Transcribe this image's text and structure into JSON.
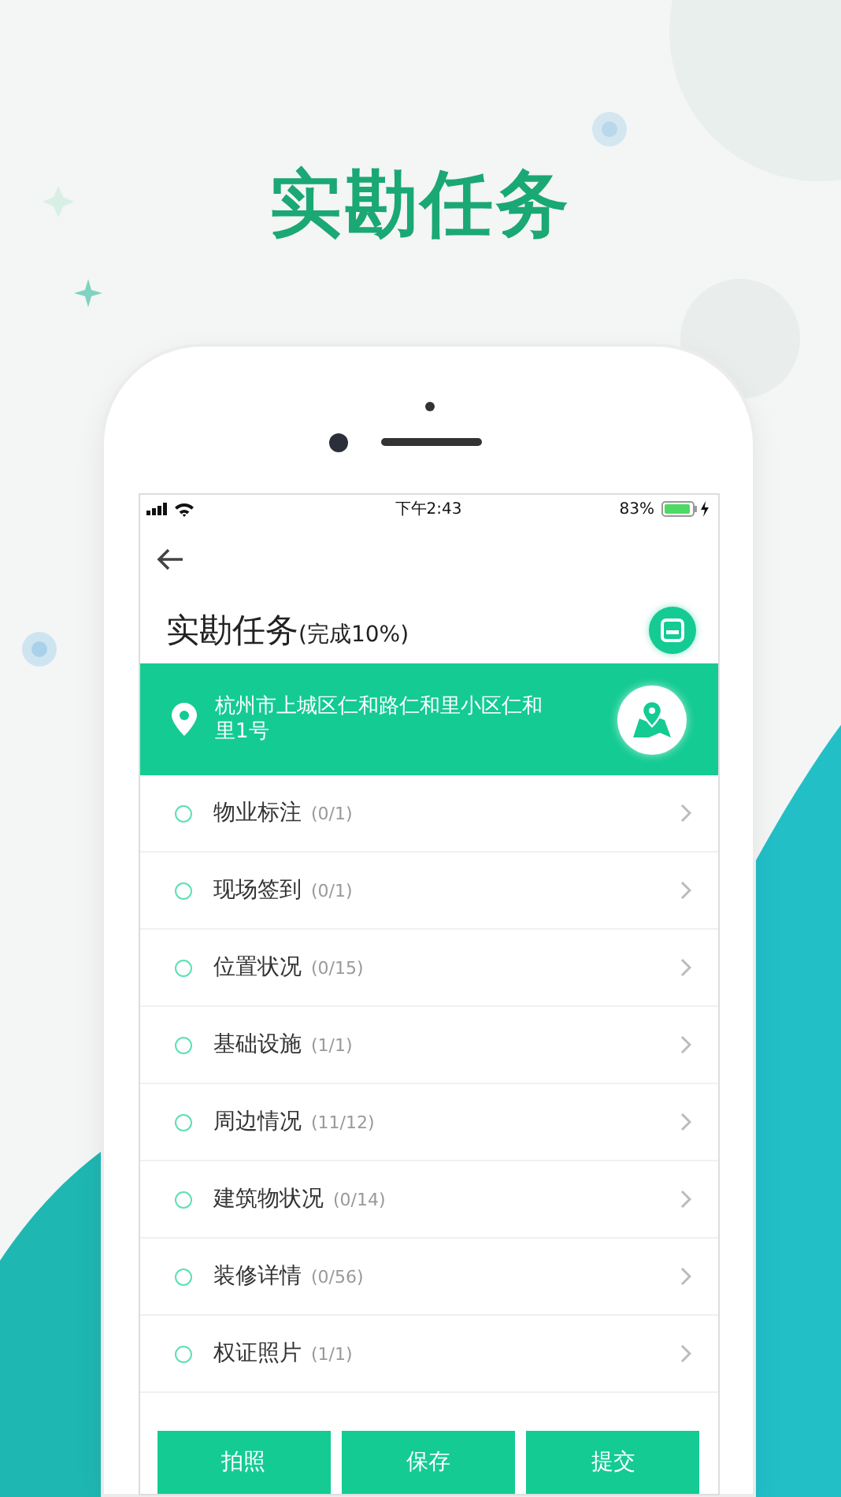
{
  "headline": "实勘任务",
  "status_bar": {
    "time": "下午2:43",
    "battery": "83%"
  },
  "header": {
    "title": "实勘任务",
    "progress": "(完成10%)"
  },
  "address": "杭州市上城区仁和路仁和里小区仁和里1号",
  "tasks": [
    {
      "label": "物业标注",
      "count": "(0/1)"
    },
    {
      "label": "现场签到",
      "count": "(0/1)"
    },
    {
      "label": "位置状况",
      "count": "(0/15)"
    },
    {
      "label": "基础设施",
      "count": "(1/1)"
    },
    {
      "label": "周边情况",
      "count": "(11/12)"
    },
    {
      "label": "建筑物状况",
      "count": "(0/14)"
    },
    {
      "label": "装修详情",
      "count": "(0/56)"
    },
    {
      "label": "权证照片",
      "count": "(1/1)"
    }
  ],
  "buttons": [
    "拍照",
    "保存",
    "提交"
  ]
}
